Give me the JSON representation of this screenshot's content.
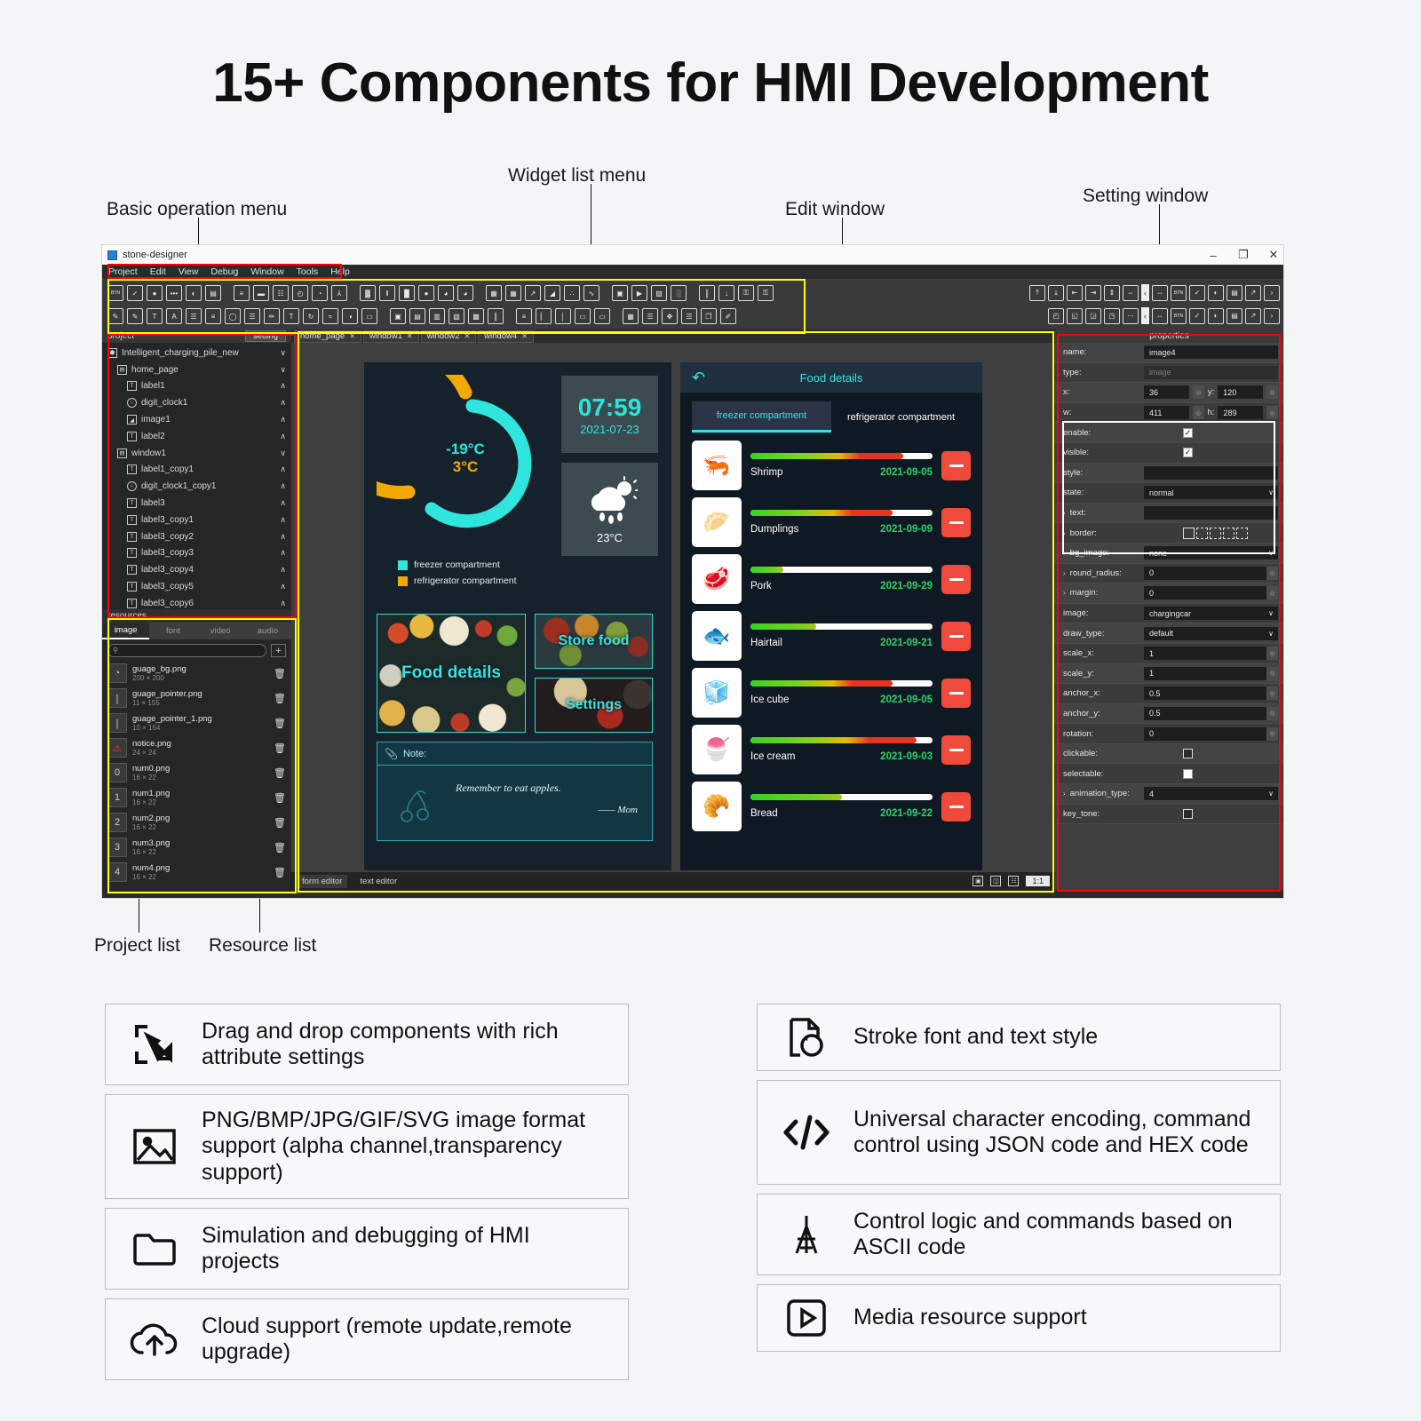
{
  "headline": "15+ Components for HMI Development",
  "callouts": [
    {
      "label": "Basic operation menu"
    },
    {
      "label": "Widget list menu"
    },
    {
      "label": "Edit window"
    },
    {
      "label": "Setting window"
    },
    {
      "label": "Project list"
    },
    {
      "label": "Resource list"
    }
  ],
  "app": {
    "title": "stone-designer",
    "window_buttons": [
      "–",
      "❐",
      "✕"
    ],
    "menu": [
      "Project",
      "Edit",
      "View",
      "Debug",
      "Window",
      "Tools",
      "Help"
    ],
    "toolbar_row1": [
      "BTN",
      "check-box",
      "radio-button",
      "text-field",
      "toggle-switch",
      "label-box",
      "slider",
      "progress-bar",
      "calendar",
      "clock",
      "gauge",
      "thermometer",
      "qr-code",
      "barcode",
      "bar-chart",
      "dial",
      "semi-dial",
      "pie-chart",
      "grid-table",
      "table",
      "line-chart",
      "area-chart",
      "scatter-chart",
      "trend-chart",
      "snapshot",
      "video",
      "image-frame",
      "matrix",
      "equalizer",
      "download",
      "lock",
      "unlock"
    ],
    "toolbar_row2": [
      "edit-pen",
      "edit-pen-2",
      "text-tool",
      "text-box",
      "form-box",
      "list-box",
      "ellipse-tool",
      "list-view",
      "paint-tool",
      "text-field-tool",
      "rotate-text",
      "animation",
      "shade",
      "stamp",
      "frame-panel",
      "frame-split",
      "split-pane",
      "group-box",
      "window-panel",
      "columns",
      "list-rows",
      "sidebar",
      "scroll-bar",
      "monitor",
      "display",
      "grid-view",
      "data-list",
      "move-widget",
      "bullet-list",
      "clone",
      "brush"
    ],
    "toolbar_right1": [
      "align-top",
      "align-bottom",
      "align-left",
      "align-right",
      "center-h",
      "center-v"
    ],
    "toolbar_right2": [
      "bring-front",
      "send-back",
      "group",
      "ungroup",
      "more"
    ],
    "toolbar_far_right": [
      "collapse-arrow",
      "resize",
      "BTN",
      "check",
      "toggle",
      "panel",
      "chart",
      "expand-arrow"
    ]
  },
  "project_panel": {
    "header": "project",
    "setting_button": "setting",
    "tree": [
      {
        "label": "Intelligent_charging_pile_new",
        "icon": "package-icon",
        "indent": 0,
        "chevron": "∨"
      },
      {
        "label": "home_page",
        "icon": "window-icon",
        "indent": 1,
        "chevron": "∨"
      },
      {
        "label": "label1",
        "icon": "text-icon",
        "indent": 2,
        "chevron": "∧"
      },
      {
        "label": "digit_clock1",
        "icon": "clock-icon",
        "indent": 2,
        "chevron": "∧"
      },
      {
        "label": "image1",
        "icon": "image-icon",
        "indent": 2,
        "chevron": "∧"
      },
      {
        "label": "label2",
        "icon": "text-icon",
        "indent": 2,
        "chevron": "∧"
      },
      {
        "label": "window1",
        "icon": "window-icon",
        "indent": 1,
        "chevron": "∨"
      },
      {
        "label": "label1_copy1",
        "icon": "text-icon",
        "indent": 2,
        "chevron": "∧"
      },
      {
        "label": "digit_clock1_copy1",
        "icon": "clock-icon",
        "indent": 2,
        "chevron": "∧"
      },
      {
        "label": "label3",
        "icon": "text-icon",
        "indent": 2,
        "chevron": "∧"
      },
      {
        "label": "label3_copy1",
        "icon": "text-icon",
        "indent": 2,
        "chevron": "∧"
      },
      {
        "label": "label3_copy2",
        "icon": "text-icon",
        "indent": 2,
        "chevron": "∧"
      },
      {
        "label": "label3_copy3",
        "icon": "text-icon",
        "indent": 2,
        "chevron": "∧"
      },
      {
        "label": "label3_copy4",
        "icon": "text-icon",
        "indent": 2,
        "chevron": "∧"
      },
      {
        "label": "label3_copy5",
        "icon": "text-icon",
        "indent": 2,
        "chevron": "∧"
      },
      {
        "label": "label3_copy6",
        "icon": "text-icon",
        "indent": 2,
        "chevron": "∧"
      }
    ]
  },
  "resources_panel": {
    "header": "resources",
    "tabs": [
      {
        "label": "image",
        "active": true
      },
      {
        "label": "font",
        "active": false
      },
      {
        "label": "video",
        "active": false
      },
      {
        "label": "audio",
        "active": false
      }
    ],
    "search_placeholder": "",
    "add_label": "+",
    "items": [
      {
        "name": "guage_bg.png",
        "size": "200 × 200",
        "glyph": "◔"
      },
      {
        "name": "guage_pointer.png",
        "size": "11 × 155",
        "glyph": "❘"
      },
      {
        "name": "guage_pointer_1.png",
        "size": "10 × 154",
        "glyph": "❘"
      },
      {
        "name": "notice.png",
        "size": "24 × 24",
        "glyph": "⚠"
      },
      {
        "name": "num0.png",
        "size": "16 × 22",
        "glyph": "0"
      },
      {
        "name": "num1.png",
        "size": "16 × 22",
        "glyph": "1"
      },
      {
        "name": "num2.png",
        "size": "16 × 22",
        "glyph": "2"
      },
      {
        "name": "num3.png",
        "size": "16 × 22",
        "glyph": "3"
      },
      {
        "name": "num4.png",
        "size": "16 × 22",
        "glyph": "4"
      }
    ]
  },
  "editor": {
    "tabs": [
      {
        "label": "home_page",
        "close": "✕"
      },
      {
        "label": "window1",
        "close": "✕"
      },
      {
        "label": "window2",
        "close": "✕"
      },
      {
        "label": "window4",
        "close": "✕"
      }
    ],
    "status": {
      "left_tabs": [
        {
          "label": "form editor",
          "active": true
        },
        {
          "label": "text editor",
          "active": false
        }
      ],
      "icons": [
        "select-mode-icon",
        "layout-icon",
        "grid-icon"
      ],
      "zoom": "1:1"
    }
  },
  "hmi_home": {
    "ring": {
      "freezer_temp": "-19°C",
      "fridge_temp": "3°C",
      "freezer_color": "#2ee6de",
      "fridge_color": "#f2a900"
    },
    "legend": [
      {
        "label": "freezer compartment",
        "color": "#2ee6de"
      },
      {
        "label": "refrigerator compartment",
        "color": "#f2a900"
      }
    ],
    "clock": {
      "time": "07:59",
      "date": "2021-07-23"
    },
    "weather": {
      "icon": "rain-sun-icon",
      "temp": "23°C"
    },
    "tiles": [
      {
        "caption": "Food details"
      },
      {
        "caption": "Store food"
      },
      {
        "caption": "Settings"
      }
    ],
    "note": {
      "label": "Note:",
      "icon": "paperclip-icon",
      "message": "Remember to eat apples.",
      "signature": "—— Mom",
      "deco_icon": "cherry-icon"
    }
  },
  "hmi_food": {
    "title": "Food details",
    "back_icon": "back-arrow-icon",
    "tabs": [
      {
        "label": "freezer compartment",
        "active": true
      },
      {
        "label": "refrigerator compartment",
        "active": false
      }
    ],
    "items": [
      {
        "name": "Shrimp",
        "date": "2021-09-05",
        "pct": 84,
        "glyph": "🦐"
      },
      {
        "name": "Dumplings",
        "date": "2021-09-09",
        "pct": 78,
        "glyph": "🥟"
      },
      {
        "name": "Pork",
        "date": "2021-09-29",
        "pct": 18,
        "glyph": "🥩"
      },
      {
        "name": "Hairtail",
        "date": "2021-09-21",
        "pct": 36,
        "glyph": "🐟"
      },
      {
        "name": "Ice cube",
        "date": "2021-09-05",
        "pct": 78,
        "glyph": "🧊"
      },
      {
        "name": "Ice cream",
        "date": "2021-09-03",
        "pct": 91,
        "glyph": "🍧"
      },
      {
        "name": "Bread",
        "date": "2021-09-22",
        "pct": 50,
        "glyph": "🥐"
      }
    ],
    "delete_icon": "minus-icon"
  },
  "properties": {
    "header": "properties",
    "rows": [
      {
        "key": "name",
        "kind": "text",
        "value": "image4"
      },
      {
        "key": "type",
        "kind": "text-dim",
        "value": "image"
      },
      {
        "key": "x",
        "kind": "xy",
        "value": "36",
        "key2": "y",
        "value2": "120"
      },
      {
        "key": "w",
        "kind": "xy",
        "value": "411",
        "key2": "h",
        "value2": "289"
      },
      {
        "key": "enable",
        "kind": "check",
        "value": "✓"
      },
      {
        "key": "visible",
        "kind": "check",
        "value": "✓"
      },
      {
        "key": "style",
        "kind": "blank",
        "value": ""
      },
      {
        "key": "state",
        "kind": "select",
        "value": "normal"
      },
      {
        "key": "text",
        "kind": "text",
        "value": "",
        "expand": "›"
      },
      {
        "key": "border",
        "kind": "border",
        "value": "",
        "expand": "›"
      },
      {
        "key": "bg_image",
        "kind": "select",
        "value": "none",
        "expand": "›"
      },
      {
        "key": "round_radius",
        "kind": "spin",
        "value": "0",
        "expand": "›"
      },
      {
        "key": "margin",
        "kind": "spin",
        "value": "0",
        "expand": "›"
      },
      {
        "key": "image",
        "kind": "select",
        "value": "chargingcar"
      },
      {
        "key": "draw_type",
        "kind": "select",
        "value": "default"
      },
      {
        "key": "scale_x",
        "kind": "spin",
        "value": "1"
      },
      {
        "key": "scale_y",
        "kind": "spin",
        "value": "1"
      },
      {
        "key": "anchor_x",
        "kind": "spin",
        "value": "0.5"
      },
      {
        "key": "anchor_y",
        "kind": "spin",
        "value": "0.5"
      },
      {
        "key": "rotation",
        "kind": "spin",
        "value": "0"
      },
      {
        "key": "clickable",
        "kind": "check-dark",
        "value": ""
      },
      {
        "key": "selectable",
        "kind": "check-empty",
        "value": ""
      },
      {
        "key": "animation_type",
        "kind": "select",
        "value": "4",
        "expand": "›"
      },
      {
        "key": "key_tone",
        "kind": "check-dark",
        "value": ""
      }
    ]
  },
  "features_left": [
    {
      "icon": "drag-drop-icon",
      "text": "Drag and drop components with rich attribute settings"
    },
    {
      "icon": "image-format-icon",
      "text": "PNG/BMP/JPG/GIF/SVG image format support (alpha channel,transparency support)"
    },
    {
      "icon": "folder-icon",
      "text": "Simulation and debugging of HMI projects"
    },
    {
      "icon": "cloud-upload-icon",
      "text": "Cloud support (remote update,remote upgrade)"
    }
  ],
  "features_right": [
    {
      "icon": "stroke-font-icon",
      "text": "Stroke font and text style"
    },
    {
      "icon": "code-icon",
      "text": "Universal character encoding, command control using JSON code and HEX code"
    },
    {
      "icon": "ascii-icon",
      "text": "Control logic and commands based on ASCII code"
    },
    {
      "icon": "media-play-icon",
      "text": "Media resource support"
    }
  ]
}
